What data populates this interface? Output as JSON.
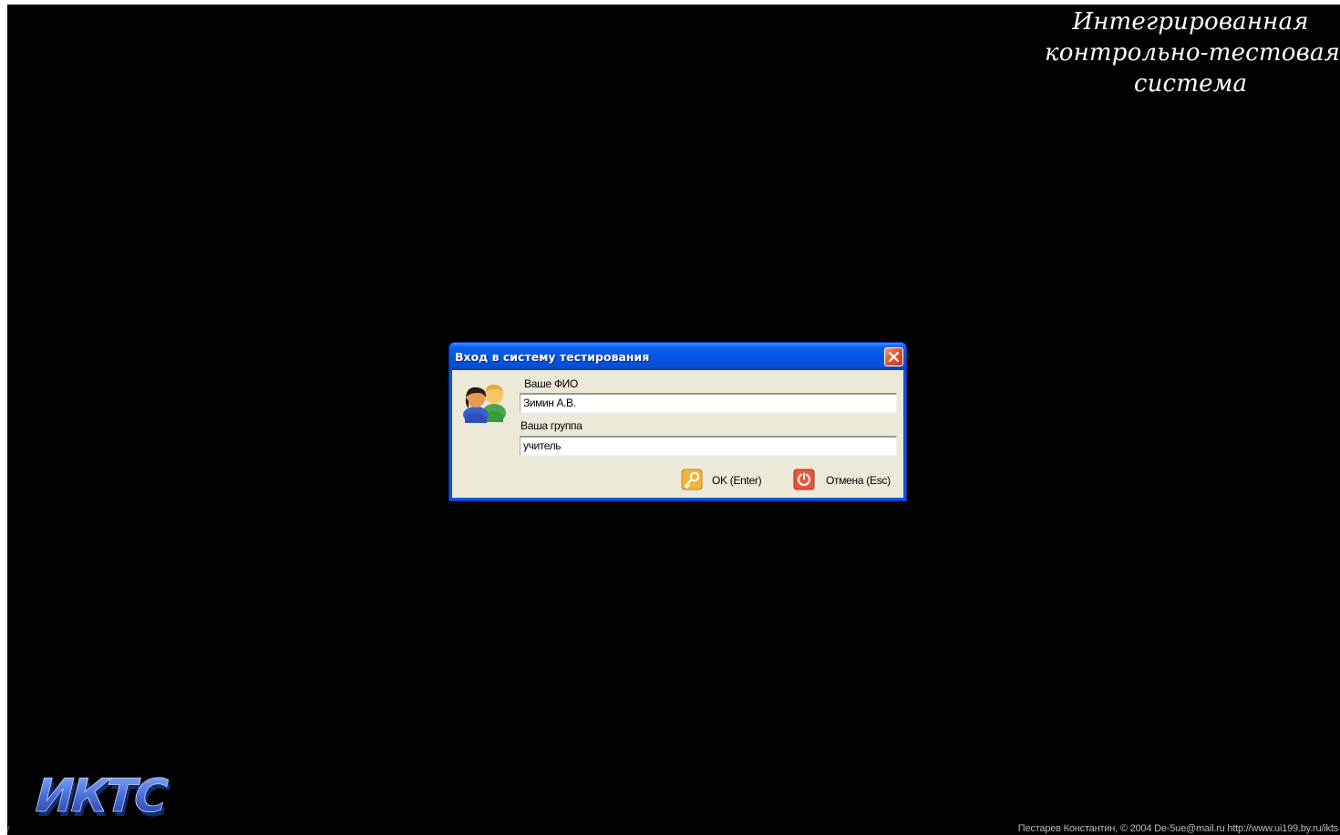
{
  "app_title": {
    "line1": "Интегрированная",
    "line2": "контрольно-тестовая",
    "line3": "система"
  },
  "logo": {
    "text": "ИКТС",
    "color": "#4a6fd8"
  },
  "footer": {
    "text": "Пестарев Константин, © 2004 De-5ue@mail.ru http://www.ui199.by.ru/ikts",
    "corner_mark": "/"
  },
  "dialog": {
    "title": "Вход в систему тестирования",
    "close_icon": "close-x-icon",
    "icon": "users-icon",
    "fio_label": "Ваше ФИО",
    "fio_value": "Зимин А.В.",
    "group_label": "Ваша группа",
    "group_value": "учитель",
    "ok_label": "OK (Enter)",
    "ok_icon": "key-icon",
    "cancel_label": "Отмена (Esc)",
    "cancel_icon": "power-icon"
  },
  "colors": {
    "background": "#000000",
    "titlebar": "#0553e3",
    "dialog_body": "#ece9d8",
    "close_button": "#e35a2d"
  }
}
